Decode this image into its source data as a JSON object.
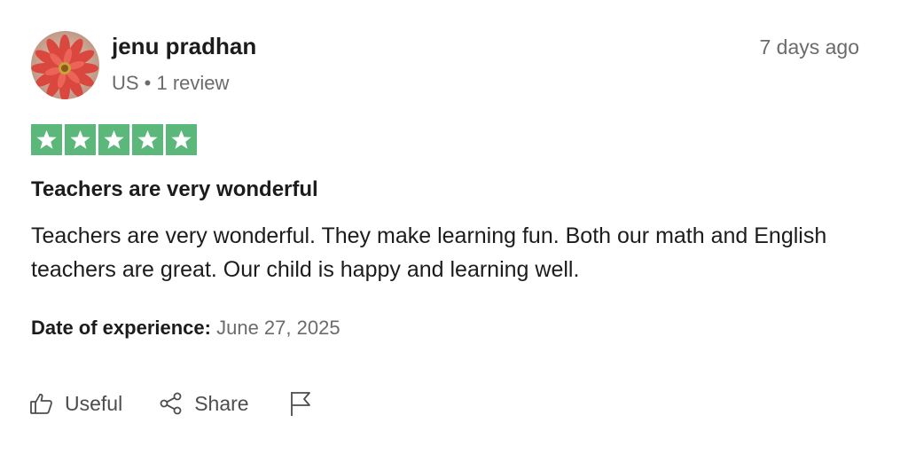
{
  "reviewer": {
    "name": "jenu pradhan",
    "meta": "US • 1 review",
    "avatar_icon": "flower-avatar"
  },
  "review": {
    "age": "7 days ago",
    "rating": 5,
    "rating_max": 5,
    "star_color": "#5cb87a",
    "title": "Teachers are very wonderful",
    "body": "Teachers are very wonderful. They make learning fun. Both our math and English teachers are great. Our child is happy and learning well.",
    "experience_label": "Date of experience:",
    "experience_date": "June 27, 2025"
  },
  "actions": {
    "useful_label": "Useful",
    "useful_icon": "thumbs-up-icon",
    "share_label": "Share",
    "share_icon": "share-icon",
    "report_icon": "flag-icon"
  }
}
